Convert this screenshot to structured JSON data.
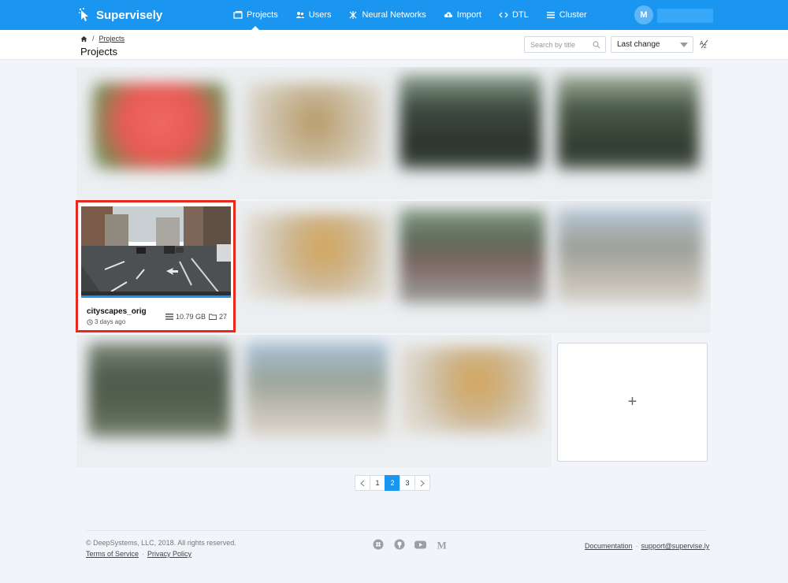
{
  "app": {
    "logo_text": "Supervisely",
    "avatar_initial": "M"
  },
  "nav": {
    "items": [
      {
        "label": "Projects",
        "icon": "projects-icon",
        "active": true
      },
      {
        "label": "Users",
        "icon": "users-icon",
        "active": false
      },
      {
        "label": "Neural Networks",
        "icon": "neural-networks-icon",
        "active": false
      },
      {
        "label": "Import",
        "icon": "cloud-upload-icon",
        "active": false
      },
      {
        "label": "DTL",
        "icon": "code-icon",
        "active": false
      },
      {
        "label": "Cluster",
        "icon": "list-icon",
        "active": false
      }
    ]
  },
  "breadcrumb": {
    "link": "Projects"
  },
  "page": {
    "title": "Projects"
  },
  "search": {
    "placeholder": "Search by title"
  },
  "sort": {
    "selected": "Last change",
    "direction_icon": "sort-direction-icon"
  },
  "highlighted_project": {
    "name": "cityscapes_orig",
    "updated": "3 days ago",
    "size": "10.79 GB",
    "datasets": "27"
  },
  "add_card": {
    "symbol": "+"
  },
  "pagination": {
    "pages": [
      "1",
      "2",
      "3"
    ],
    "current": "2"
  },
  "footer": {
    "copyright": "© DeepSystems, LLC, 2018. All rights reserved.",
    "terms": "Terms of Service",
    "privacy": "Privacy Policy",
    "documentation": "Documentation",
    "support": "support@supervise.ly",
    "social_icons": [
      "slack-icon",
      "github-icon",
      "youtube-icon",
      "medium-icon"
    ]
  },
  "colors": {
    "primary": "#1a96f0",
    "highlight": "#e7291d"
  }
}
